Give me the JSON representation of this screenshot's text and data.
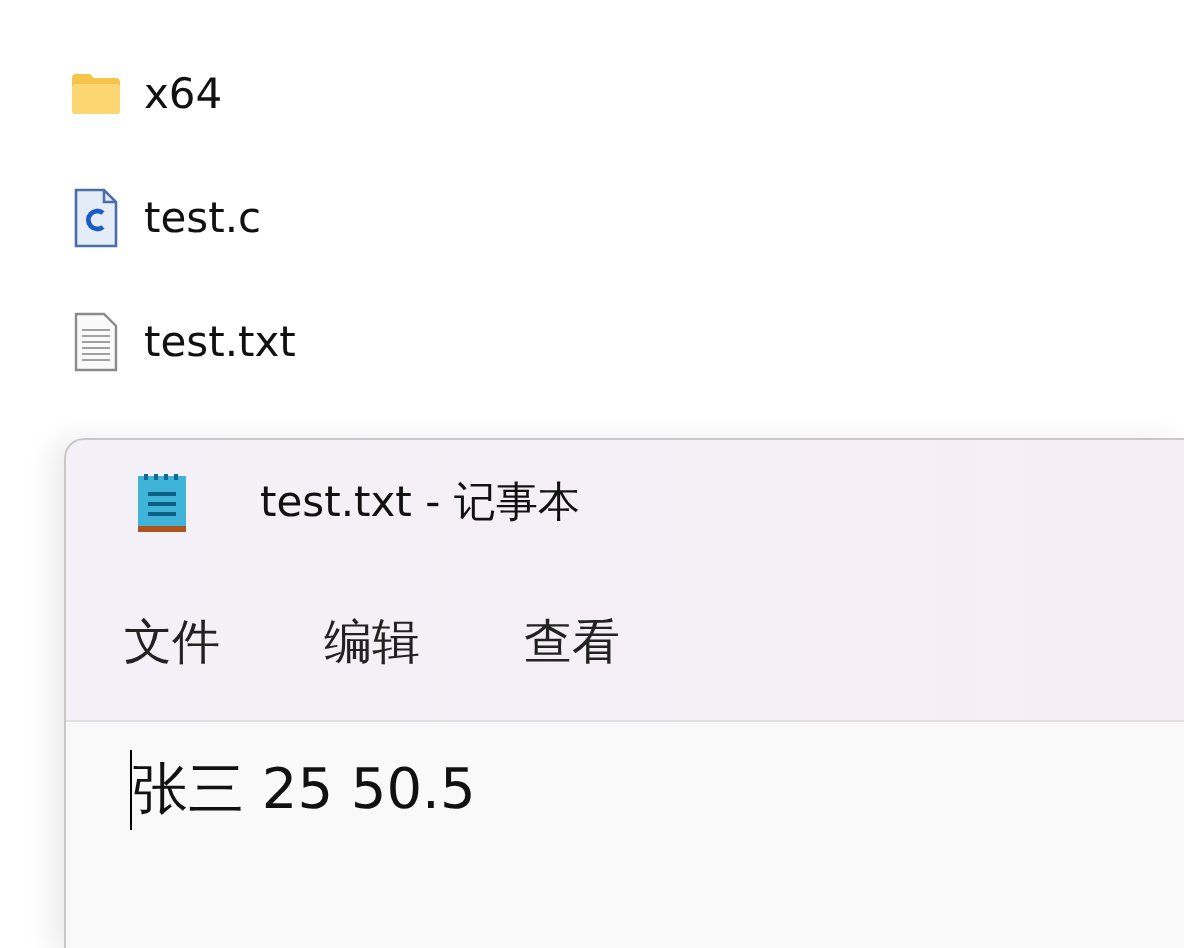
{
  "files": [
    {
      "kind": "folder",
      "name": "x64"
    },
    {
      "kind": "c-source",
      "name": "test.c"
    },
    {
      "kind": "text",
      "name": "test.txt"
    }
  ],
  "window": {
    "title": "test.txt - 记事本",
    "menu": [
      "文件",
      "编辑",
      "查看"
    ],
    "content": "张三 25 50.5"
  }
}
